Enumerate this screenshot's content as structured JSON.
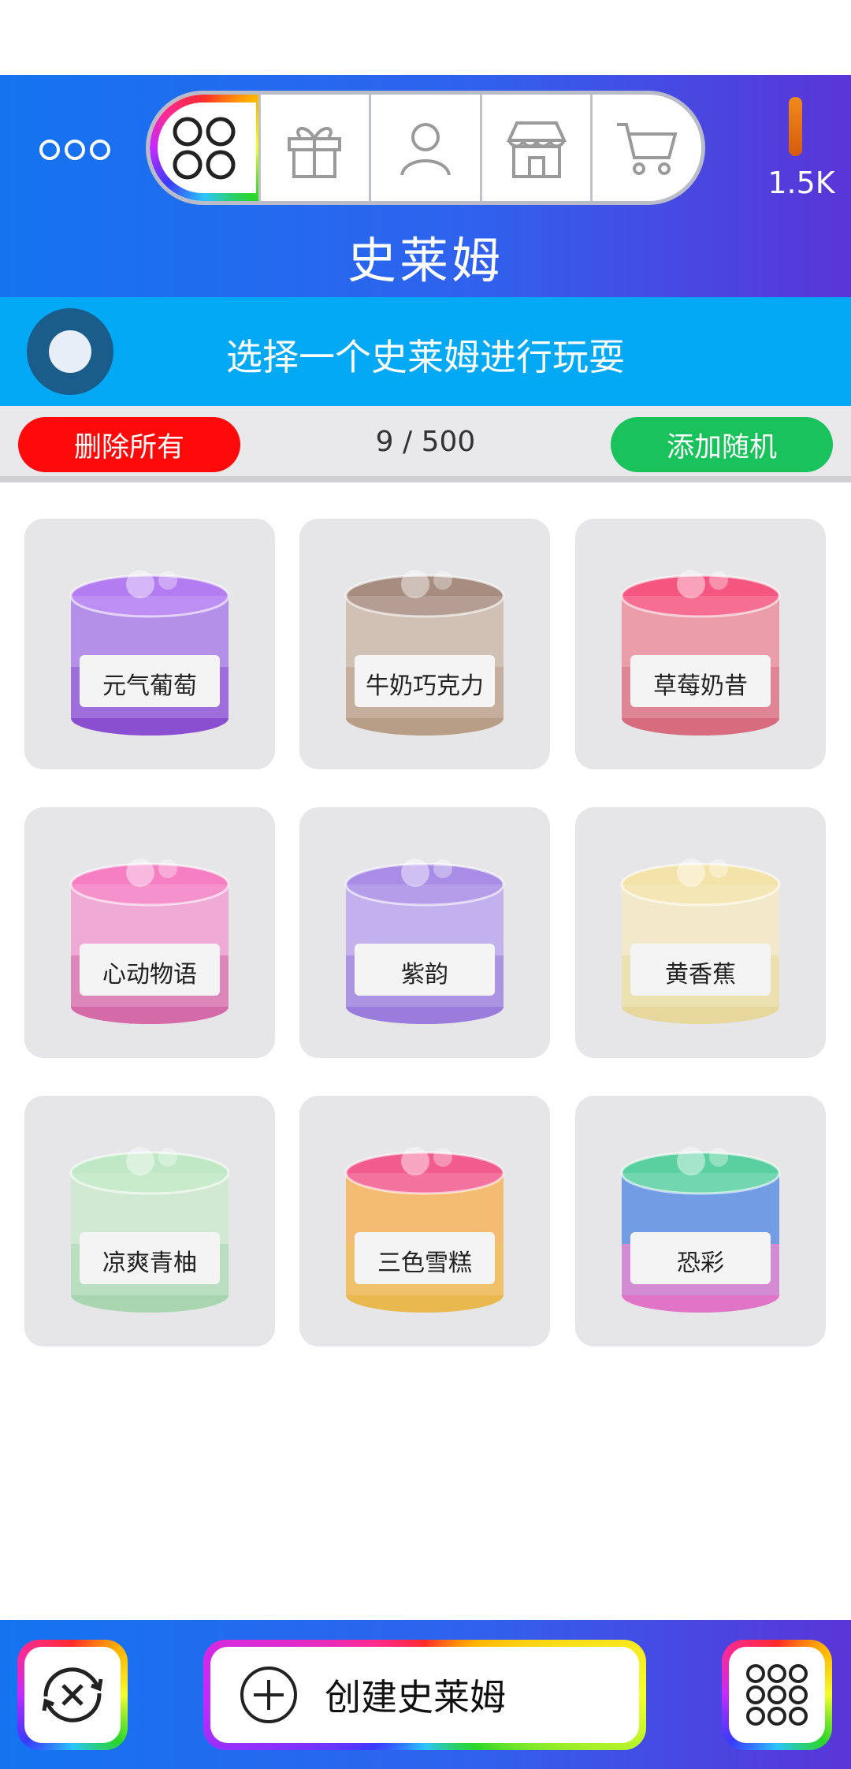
{
  "header": {
    "title": "史莱姆",
    "currency": "1.5K",
    "tabs": [
      {
        "name": "home-tab",
        "icon": "four-circles-icon",
        "active": true
      },
      {
        "name": "gift-tab",
        "icon": "gift-icon",
        "active": false
      },
      {
        "name": "profile-tab",
        "icon": "user-icon",
        "active": false
      },
      {
        "name": "shop-tab",
        "icon": "store-icon",
        "active": false
      },
      {
        "name": "cart-tab",
        "icon": "cart-icon",
        "active": false
      }
    ]
  },
  "banner": {
    "text": "选择一个史莱姆进行玩耍"
  },
  "actions": {
    "delete_all": "删除所有",
    "count": "9 / 500",
    "add_random": "添加随机"
  },
  "slimes": [
    {
      "label": "元气葡萄",
      "top": "#b37cf0",
      "body": "#a97de6",
      "bottom": "#8a4fd0"
    },
    {
      "label": "牛奶巧克力",
      "top": "#a78c80",
      "body": "#c9b7a7",
      "bottom": "#b89e86"
    },
    {
      "label": "草莓奶昔",
      "top": "#f55680",
      "body": "#e98c9c",
      "bottom": "#d76c7e"
    },
    {
      "label": "心动物语",
      "top": "#f57fc2",
      "body": "#ee9ccf",
      "bottom": "#d46aa8"
    },
    {
      "label": "紫韵",
      "top": "#a88ce6",
      "body": "#b9a4ec",
      "bottom": "#9a7cdc"
    },
    {
      "label": "黄香蕉",
      "top": "#f3e3a8",
      "body": "#efe6c0",
      "bottom": "#e6d89c"
    },
    {
      "label": "凉爽青柚",
      "top": "#bfe8c4",
      "body": "#c9e6cc",
      "bottom": "#a9d6b0"
    },
    {
      "label": "三色雪糕",
      "top": "#f25b8e",
      "body": "#f3b05b",
      "bottom": "#e9b84f"
    },
    {
      "label": "恐彩",
      "top": "#5ad0a0",
      "body": "#5a8ce0",
      "bottom": "#e074c6"
    }
  ],
  "bottom_bar": {
    "shuffle_icon": "shuffle-icon",
    "create_label": "创建史莱姆",
    "create_icon": "plus-circle-icon",
    "grid_icon": "nine-circles-icon"
  }
}
